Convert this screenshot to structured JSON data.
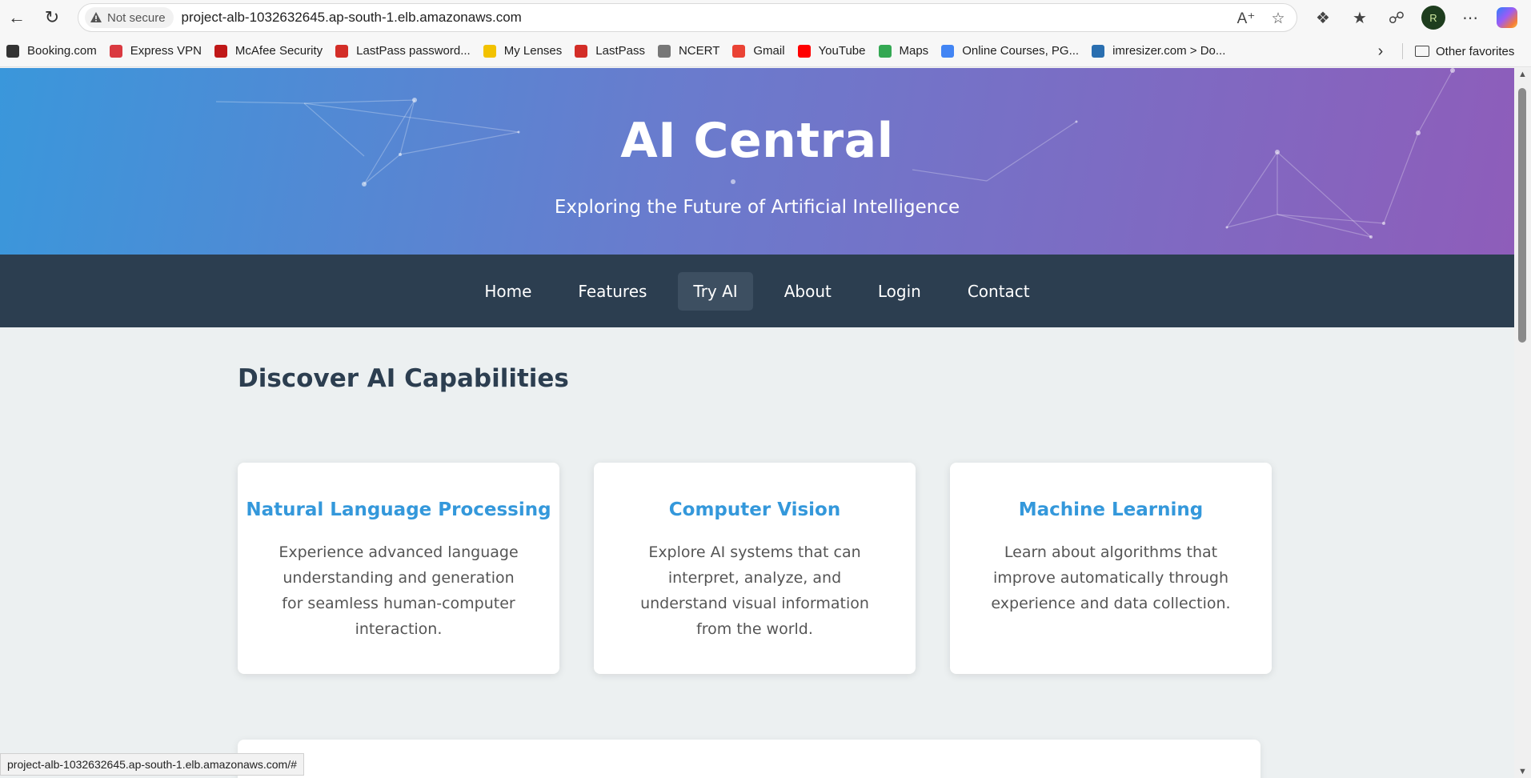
{
  "browser": {
    "not_secure_label": "Not secure",
    "url": "project-alb-1032632645.ap-south-1.elb.amazonaws.com",
    "profile_initial": "R",
    "bookmarks": [
      {
        "label": "Booking.com",
        "icon": "globe-icon",
        "color": "#333333"
      },
      {
        "label": "Express VPN",
        "icon": "expressvpn-icon",
        "color": "#da3940"
      },
      {
        "label": "McAfee Security",
        "icon": "mcafee-icon",
        "color": "#c01818"
      },
      {
        "label": "LastPass password...",
        "icon": "lastpass-icon",
        "color": "#d32d27"
      },
      {
        "label": "My Lenses",
        "icon": "lens-icon",
        "color": "#f2c200"
      },
      {
        "label": "LastPass",
        "icon": "lastpass-icon",
        "color": "#d32d27"
      },
      {
        "label": "NCERT",
        "icon": "ncert-icon",
        "color": "#777777"
      },
      {
        "label": "Gmail",
        "icon": "gmail-icon",
        "color": "#ea4335"
      },
      {
        "label": "YouTube",
        "icon": "youtube-icon",
        "color": "#ff0000"
      },
      {
        "label": "Maps",
        "icon": "maps-icon",
        "color": "#34a853"
      },
      {
        "label": "Online Courses, PG...",
        "icon": "google-icon",
        "color": "#4285f4"
      },
      {
        "label": "imresizer.com > Do...",
        "icon": "imresizer-icon",
        "color": "#2a6fb0"
      }
    ],
    "other_favorites": "Other favorites",
    "status_url": "project-alb-1032632645.ap-south-1.elb.amazonaws.com/#"
  },
  "hero": {
    "title": "AI Central",
    "subtitle": "Exploring the Future of Artificial Intelligence"
  },
  "nav": {
    "items": [
      "Home",
      "Features",
      "Try AI",
      "About",
      "Login",
      "Contact"
    ],
    "active": "Try AI"
  },
  "main": {
    "section_title": "Discover AI Capabilities",
    "cards": [
      {
        "title": "Natural Language Processing",
        "desc": "Experience advanced language understanding and generation for seamless human-computer interaction."
      },
      {
        "title": "Computer Vision",
        "desc": "Explore AI systems that can interpret, analyze, and understand visual information from the world."
      },
      {
        "title": "Machine Learning",
        "desc": "Learn about algorithms that improve automatically through experience and data collection."
      }
    ]
  },
  "colors": {
    "nav_bg": "#2c3e50",
    "accent": "#3498db",
    "hero_start": "#3a97db",
    "hero_end": "#8e5dba",
    "page_bg": "#ecf0f1"
  }
}
